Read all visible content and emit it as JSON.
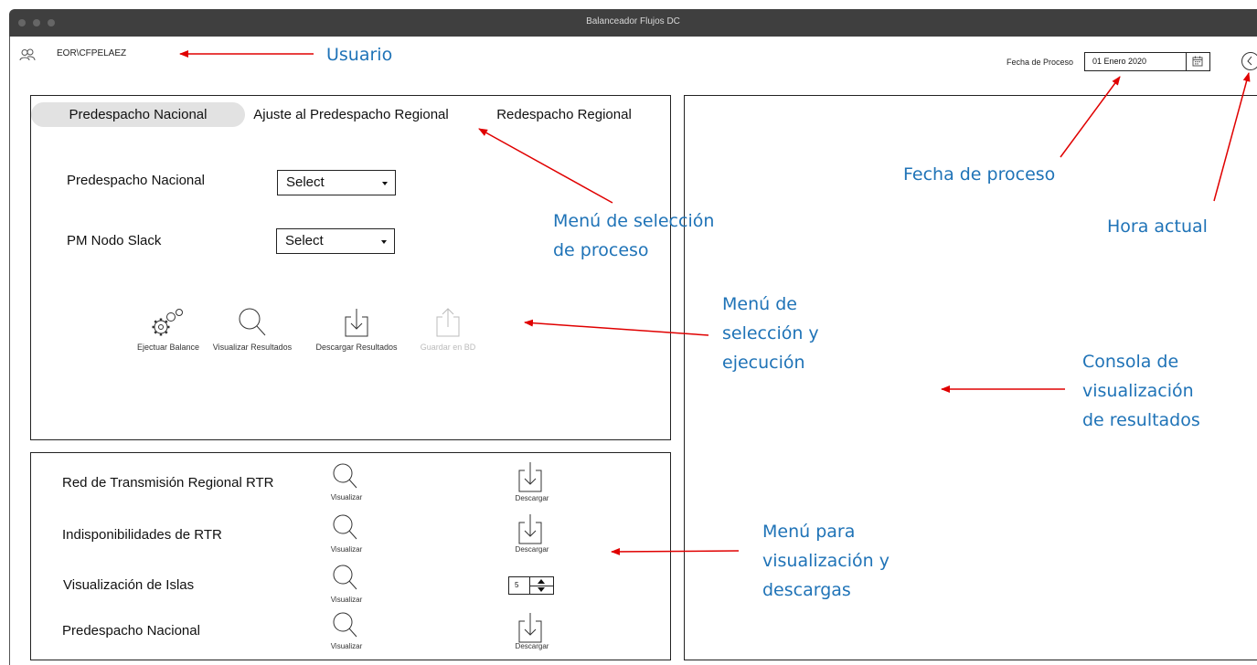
{
  "window": {
    "title": "Balanceador Flujos DC"
  },
  "header": {
    "user": "EOR\\CFPELAEZ",
    "process_date_label": "Fecha de Proceso",
    "process_date_value": "01 Enero 2020"
  },
  "tabs": [
    "Predespacho Nacional",
    "Ajuste al Predespacho Regional",
    "Redespacho Regional"
  ],
  "selection": {
    "row1_label": "Predespacho Nacional",
    "row1_value": "Select",
    "row2_label": "PM Nodo Slack",
    "row2_value": "Select"
  },
  "actions": [
    "Ejectuar Balance",
    "Visualizar Resultados",
    "Descargar Resultados",
    "Guardar en BD"
  ],
  "downloads": {
    "rows": [
      "Red de Transmisión Regional RTR",
      "Indisponibilidades de RTR",
      "Visualización de Islas",
      "Predespacho Nacional"
    ],
    "view_label": "Visualizar",
    "download_label": "Descargar",
    "islands_stepper_value": "5"
  },
  "annotations": {
    "user": "Usuario",
    "process_menu": [
      "Menú de selección",
      "de proceso"
    ],
    "selection_menu": [
      "Menú de",
      "selección y",
      "ejecución"
    ],
    "downloads_menu": [
      "Menú para",
      "visualización y",
      "descargas"
    ],
    "process_date": "Fecha de proceso",
    "current_time": "Hora actual",
    "console": [
      "Consola de",
      "visualización",
      "de resultados"
    ]
  },
  "colors": {
    "annotation_text": "#1f73b7",
    "arrow": "#e00000",
    "titlebar": "#3f3f3f",
    "selected_tab": "#e2e2e2"
  }
}
